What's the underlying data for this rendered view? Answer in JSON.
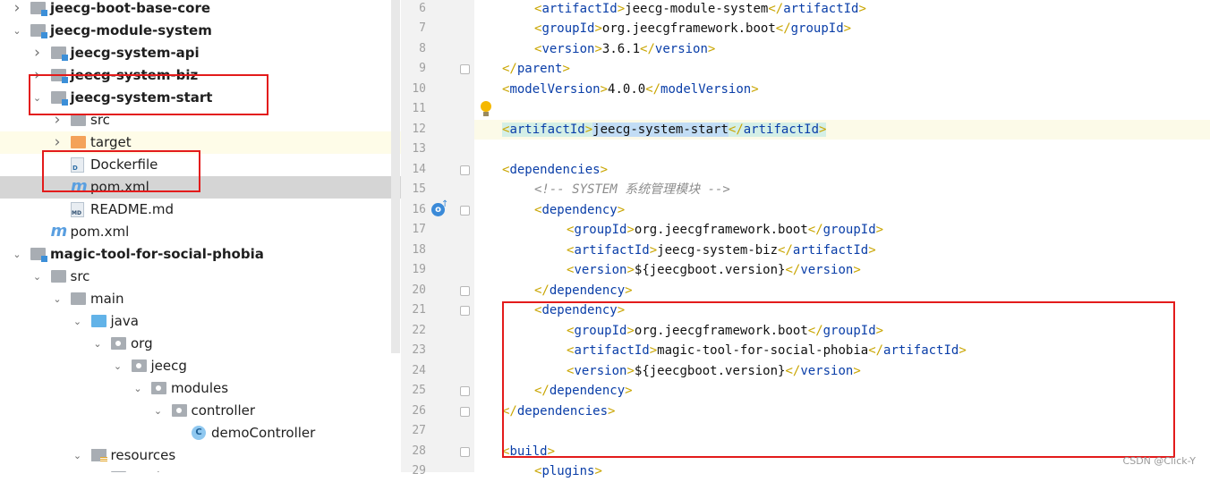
{
  "tree": {
    "rows": [
      {
        "label": "jeecg-boot-base-core",
        "bold": true,
        "depth": 1,
        "icon": "module-folder-icon",
        "arrow": "right"
      },
      {
        "label": "jeecg-module-system",
        "bold": true,
        "depth": 1,
        "icon": "module-folder-icon",
        "arrow": "down"
      },
      {
        "label": "jeecg-system-api",
        "bold": true,
        "depth": 2,
        "icon": "module-folder-icon",
        "arrow": "right"
      },
      {
        "label": "jeecg-system-biz",
        "bold": true,
        "depth": 2,
        "icon": "module-folder-icon",
        "arrow": "right"
      },
      {
        "label": "jeecg-system-start",
        "bold": true,
        "depth": 2,
        "icon": "module-folder-icon",
        "arrow": "down"
      },
      {
        "label": "src",
        "bold": false,
        "depth": 3,
        "icon": "folder-icon",
        "arrow": "right"
      },
      {
        "label": "target",
        "bold": false,
        "depth": 3,
        "icon": "excluded-folder-icon",
        "arrow": "right"
      },
      {
        "label": "Dockerfile",
        "bold": false,
        "depth": 3,
        "icon": "dockerfile-icon",
        "arrow": ""
      },
      {
        "label": "pom.xml",
        "bold": false,
        "depth": 3,
        "icon": "maven-icon",
        "arrow": ""
      },
      {
        "label": "README.md",
        "bold": false,
        "depth": 3,
        "icon": "markdown-file-icon",
        "arrow": ""
      },
      {
        "label": "pom.xml",
        "bold": false,
        "depth": 2,
        "icon": "maven-icon",
        "arrow": ""
      },
      {
        "label": "magic-tool-for-social-phobia",
        "bold": true,
        "depth": 1,
        "icon": "module-folder-icon",
        "arrow": "down"
      },
      {
        "label": "src",
        "bold": false,
        "depth": 2,
        "icon": "folder-icon",
        "arrow": "down"
      },
      {
        "label": "main",
        "bold": false,
        "depth": 3,
        "icon": "folder-icon",
        "arrow": "down"
      },
      {
        "label": "java",
        "bold": false,
        "depth": 4,
        "icon": "source-folder-icon",
        "arrow": "down"
      },
      {
        "label": "org",
        "bold": false,
        "depth": 5,
        "icon": "package-icon",
        "arrow": "down"
      },
      {
        "label": "jeecg",
        "bold": false,
        "depth": 6,
        "icon": "package-icon",
        "arrow": "down"
      },
      {
        "label": "modules",
        "bold": false,
        "depth": 7,
        "icon": "package-icon",
        "arrow": "down"
      },
      {
        "label": "controller",
        "bold": false,
        "depth": 8,
        "icon": "package-icon",
        "arrow": "down"
      },
      {
        "label": "demoController",
        "bold": false,
        "depth": 9,
        "icon": "class-icon",
        "arrow": ""
      },
      {
        "label": "resources",
        "bold": false,
        "depth": 4,
        "icon": "resources-folder-icon",
        "arrow": "down"
      },
      {
        "label": "static",
        "bold": false,
        "depth": 5,
        "icon": "folder-icon",
        "arrow": ""
      }
    ]
  },
  "editor": {
    "lines": [
      {
        "n": "6",
        "indent": 1,
        "parts": [
          [
            "br",
            "<"
          ],
          [
            "tag",
            "artifactId"
          ],
          [
            "br",
            ">"
          ],
          [
            "txt",
            "jeecg-module-system"
          ],
          [
            "br",
            "</"
          ],
          [
            "tag",
            "artifactId"
          ],
          [
            "br",
            ">"
          ]
        ]
      },
      {
        "n": "7",
        "indent": 1,
        "parts": [
          [
            "br",
            "<"
          ],
          [
            "tag",
            "groupId"
          ],
          [
            "br",
            ">"
          ],
          [
            "txt",
            "org.jeecgframework.boot"
          ],
          [
            "br",
            "</"
          ],
          [
            "tag",
            "groupId"
          ],
          [
            "br",
            ">"
          ]
        ]
      },
      {
        "n": "8",
        "indent": 1,
        "parts": [
          [
            "br",
            "<"
          ],
          [
            "tag",
            "version"
          ],
          [
            "br",
            ">"
          ],
          [
            "txt",
            "3.6.1"
          ],
          [
            "br",
            "</"
          ],
          [
            "tag",
            "version"
          ],
          [
            "br",
            ">"
          ]
        ]
      },
      {
        "n": "9",
        "indent": 0,
        "parts": [
          [
            "br",
            "</"
          ],
          [
            "tag",
            "parent"
          ],
          [
            "br",
            ">"
          ]
        ]
      },
      {
        "n": "10",
        "indent": 0,
        "parts": [
          [
            "br",
            "<"
          ],
          [
            "tag",
            "modelVersion"
          ],
          [
            "br",
            ">"
          ],
          [
            "txt",
            "4.0.0"
          ],
          [
            "br",
            "</"
          ],
          [
            "tag",
            "modelVersion"
          ],
          [
            "br",
            ">"
          ]
        ]
      },
      {
        "n": "11",
        "indent": 0,
        "parts": []
      },
      {
        "n": "12",
        "indent": 0,
        "parts": [
          [
            "tagbg",
            "<artifactId>"
          ],
          [
            "sel",
            "jeecg-system-start"
          ],
          [
            "tagbg",
            "</artifactId>"
          ]
        ]
      },
      {
        "n": "13",
        "indent": 0,
        "parts": []
      },
      {
        "n": "14",
        "indent": 0,
        "parts": [
          [
            "br",
            "<"
          ],
          [
            "tag",
            "dependencies"
          ],
          [
            "br",
            ">"
          ]
        ]
      },
      {
        "n": "15",
        "indent": 1,
        "parts": [
          [
            "cmt",
            "<!-- SYSTEM 系统管理模块 -->"
          ]
        ]
      },
      {
        "n": "16",
        "indent": 1,
        "parts": [
          [
            "br",
            "<"
          ],
          [
            "tag",
            "dependency"
          ],
          [
            "br",
            ">"
          ]
        ]
      },
      {
        "n": "17",
        "indent": 2,
        "parts": [
          [
            "br",
            "<"
          ],
          [
            "tag",
            "groupId"
          ],
          [
            "br",
            ">"
          ],
          [
            "txt",
            "org.jeecgframework.boot"
          ],
          [
            "br",
            "</"
          ],
          [
            "tag",
            "groupId"
          ],
          [
            "br",
            ">"
          ]
        ]
      },
      {
        "n": "18",
        "indent": 2,
        "parts": [
          [
            "br",
            "<"
          ],
          [
            "tag",
            "artifactId"
          ],
          [
            "br",
            ">"
          ],
          [
            "txt",
            "jeecg-system-biz"
          ],
          [
            "br",
            "</"
          ],
          [
            "tag",
            "artifactId"
          ],
          [
            "br",
            ">"
          ]
        ]
      },
      {
        "n": "19",
        "indent": 2,
        "parts": [
          [
            "br",
            "<"
          ],
          [
            "tag",
            "version"
          ],
          [
            "br",
            ">"
          ],
          [
            "txt",
            "${jeecgboot.version}"
          ],
          [
            "br",
            "</"
          ],
          [
            "tag",
            "version"
          ],
          [
            "br",
            ">"
          ]
        ]
      },
      {
        "n": "20",
        "indent": 1,
        "parts": [
          [
            "br",
            "</"
          ],
          [
            "tag",
            "dependency"
          ],
          [
            "br",
            ">"
          ]
        ]
      },
      {
        "n": "21",
        "indent": 1,
        "parts": [
          [
            "br",
            "<"
          ],
          [
            "tag",
            "dependency"
          ],
          [
            "br",
            ">"
          ]
        ]
      },
      {
        "n": "22",
        "indent": 2,
        "parts": [
          [
            "br",
            "<"
          ],
          [
            "tag",
            "groupId"
          ],
          [
            "br",
            ">"
          ],
          [
            "txt",
            "org.jeecgframework.boot"
          ],
          [
            "br",
            "</"
          ],
          [
            "tag",
            "groupId"
          ],
          [
            "br",
            ">"
          ]
        ]
      },
      {
        "n": "23",
        "indent": 2,
        "parts": [
          [
            "br",
            "<"
          ],
          [
            "tag",
            "artifactId"
          ],
          [
            "br",
            ">"
          ],
          [
            "txt",
            "magic-tool-for-social-phobia"
          ],
          [
            "br",
            "</"
          ],
          [
            "tag",
            "artifactId"
          ],
          [
            "br",
            ">"
          ]
        ]
      },
      {
        "n": "24",
        "indent": 2,
        "parts": [
          [
            "br",
            "<"
          ],
          [
            "tag",
            "version"
          ],
          [
            "br",
            ">"
          ],
          [
            "txt",
            "${jeecgboot.version}"
          ],
          [
            "br",
            "</"
          ],
          [
            "tag",
            "version"
          ],
          [
            "br",
            ">"
          ]
        ]
      },
      {
        "n": "25",
        "indent": 1,
        "parts": [
          [
            "br",
            "</"
          ],
          [
            "tag",
            "dependency"
          ],
          [
            "br",
            ">"
          ]
        ]
      },
      {
        "n": "26",
        "indent": 0,
        "parts": [
          [
            "br",
            "</"
          ],
          [
            "tag",
            "dependencies"
          ],
          [
            "br",
            ">"
          ]
        ]
      },
      {
        "n": "27",
        "indent": 0,
        "parts": []
      },
      {
        "n": "28",
        "indent": 0,
        "parts": [
          [
            "br",
            "<"
          ],
          [
            "tag",
            "build"
          ],
          [
            "br",
            ">"
          ]
        ]
      },
      {
        "n": "29",
        "indent": 1,
        "parts": [
          [
            "br",
            "<"
          ],
          [
            "tag",
            "plugins"
          ],
          [
            "br",
            ">"
          ]
        ]
      }
    ]
  },
  "watermark": "CSDN @Click-Y",
  "colors": {
    "tag": "#0a3ea8",
    "bracket": "#c9a500",
    "comment": "#8c8c8c",
    "annotation_box": "#e31b1b"
  }
}
